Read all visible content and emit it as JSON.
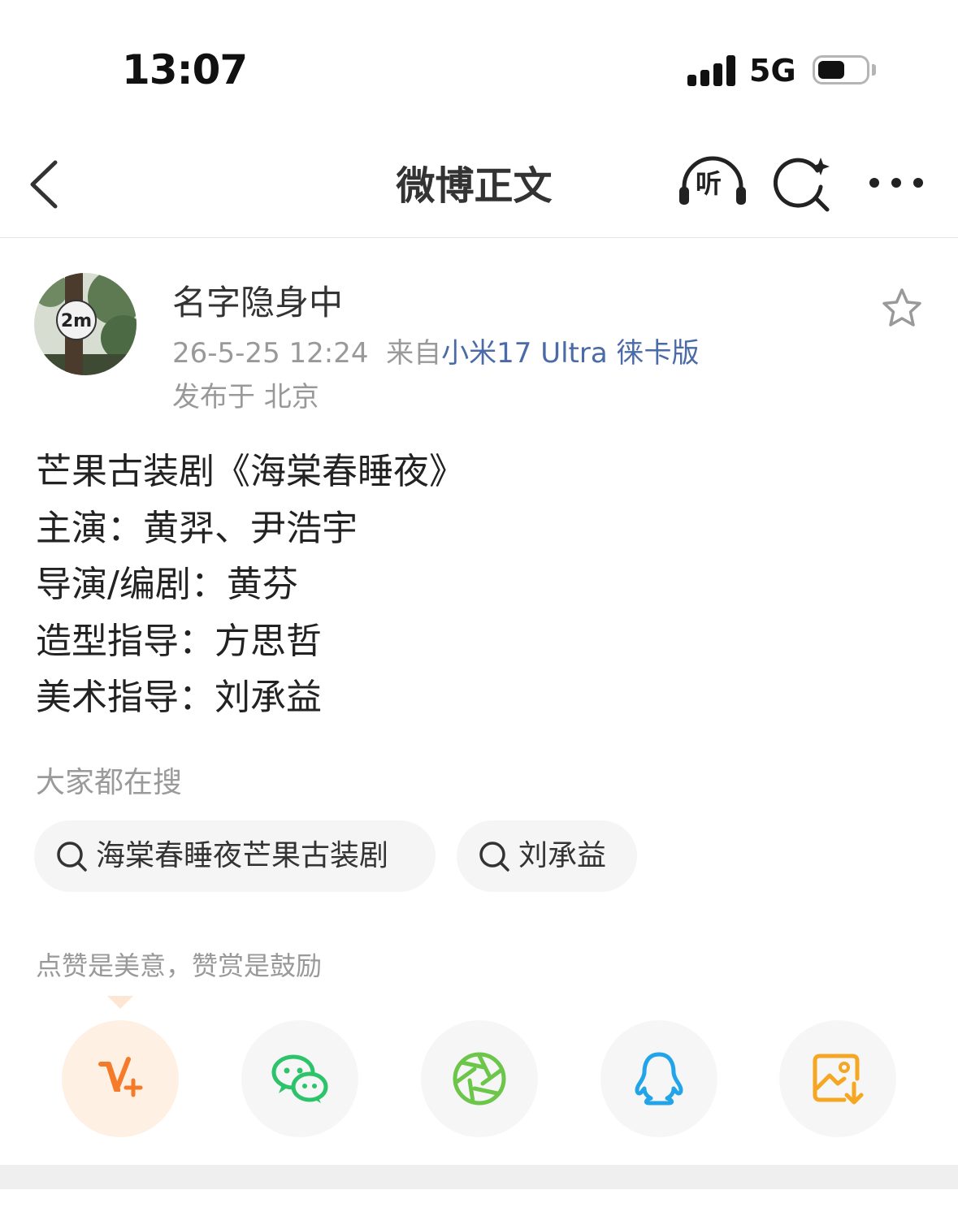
{
  "status_bar": {
    "time": "13:07",
    "network": "5G"
  },
  "nav": {
    "title": "微博正文",
    "listen_label": "听",
    "icons": [
      "back-icon",
      "listen-headphones-icon",
      "ai-search-icon",
      "more-icon"
    ]
  },
  "post": {
    "author": "名字隐身中",
    "timestamp": "26-5-25 12:24",
    "source_prefix": "来自",
    "device": "小米17 Ultra 徕卡版",
    "location": "发布于 北京",
    "lines": [
      "芒果古装剧《海棠春睡夜》",
      "主演：黄羿、尹浩宇",
      "导演/编剧：黄芬",
      "造型指导：方思哲",
      "美术指导：刘承益"
    ]
  },
  "search": {
    "heading": "大家都在搜",
    "chips": [
      "海棠春睡夜芒果古装剧",
      "刘承益"
    ]
  },
  "reward": {
    "tip": "点赞是美意，赞赏是鼓励"
  },
  "share": {
    "items": [
      "vip-reward-icon",
      "wechat-icon",
      "moments-icon",
      "qq-icon",
      "save-image-icon"
    ],
    "colors": {
      "vip": "#f47b2a",
      "wechat": "#2dc36a",
      "moments": "#6cc64a",
      "qq": "#22a4e8",
      "save": "#f5a623"
    }
  },
  "avatar": {
    "sign_text": "2m"
  }
}
